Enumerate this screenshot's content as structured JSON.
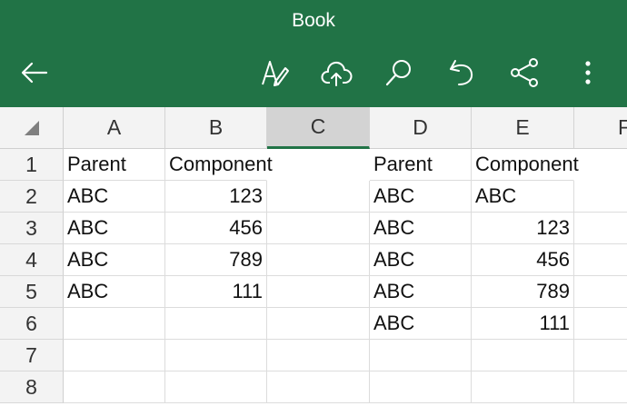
{
  "app": {
    "title": "Book"
  },
  "toolbar": {
    "icons": [
      "back-arrow-icon",
      "edit-pen-icon",
      "cloud-upload-icon",
      "search-icon",
      "undo-icon",
      "share-icon",
      "more-icon"
    ]
  },
  "sheet": {
    "columns": [
      "A",
      "B",
      "C",
      "D",
      "E",
      "F"
    ],
    "selected_column": "C",
    "rows": [
      "1",
      "2",
      "3",
      "4",
      "5",
      "6",
      "7",
      "8"
    ],
    "cells": {
      "A1": "Parent",
      "B1": "Component",
      "D1": "Parent",
      "E1": "Component",
      "A2": "ABC",
      "B2": "123",
      "D2": "ABC",
      "E2": "ABC",
      "A3": "ABC",
      "B3": "456",
      "D3": "ABC",
      "E3": "123",
      "A4": "ABC",
      "B4": "789",
      "D4": "ABC",
      "E4": "456",
      "A5": "ABC",
      "B5": "111",
      "D5": "ABC",
      "E5": "789",
      "D6": "ABC",
      "E6": "111"
    }
  },
  "colors": {
    "accent": "#217346",
    "header_bg": "#f3f3f3",
    "selected_header": "#d3d3d3"
  }
}
